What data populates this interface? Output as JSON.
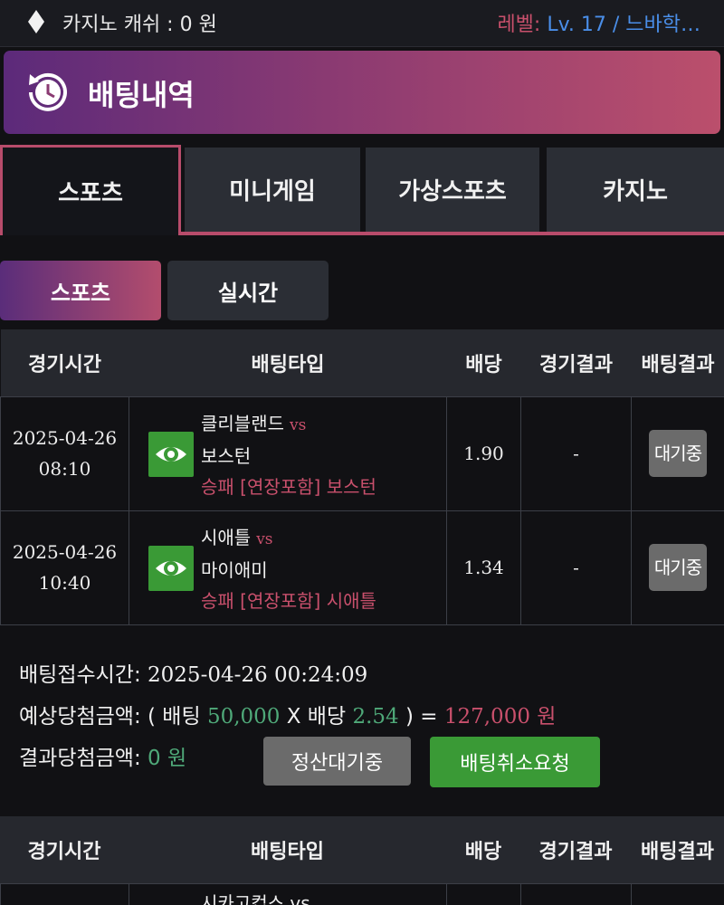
{
  "topbar": {
    "cash_label": "카지노 캐쉬 :  0 원",
    "level_prefix": "레벨: ",
    "level_value": "Lv. 17 / 느바학…"
  },
  "banner": {
    "title": "배팅내역",
    "icon": "history-clock-icon"
  },
  "tabs": [
    {
      "label": "스포츠",
      "active": true
    },
    {
      "label": "미니게임",
      "active": false
    },
    {
      "label": "가상스포츠",
      "active": false
    },
    {
      "label": "카지노",
      "active": false
    }
  ],
  "subtabs": [
    {
      "label": "스포츠",
      "active": true
    },
    {
      "label": "실시간",
      "active": false
    }
  ],
  "table_headers": [
    "경기시간",
    "배팅타입",
    "배당",
    "경기결과",
    "배팅결과"
  ],
  "bet_slip_1": {
    "rows": [
      {
        "date": "2025-04-26",
        "time": "08:10",
        "home": "클리블랜드",
        "vs": "vs",
        "away": "보스턴",
        "pick": "승패 [연장포함] 보스턴",
        "odds": "1.90",
        "result": "-",
        "status": "대기중"
      },
      {
        "date": "2025-04-26",
        "time": "10:40",
        "home": "시애틀",
        "vs": "vs",
        "away": "마이애미",
        "pick": "승패 [연장포함] 시애틀",
        "odds": "1.34",
        "result": "-",
        "status": "대기중"
      }
    ],
    "summary": {
      "time_label": "배팅접수시간: ",
      "time_value": "2025-04-26 00:24:09",
      "expected_label": "예상당첨금액: ( 배팅 ",
      "stake": "50,000",
      "x_odds": " X 배당 ",
      "total_odds": "2.54",
      "eq": " ) = ",
      "payout": "127,000 원",
      "result_label": "결과당첨금액: ",
      "result_value": "0 원",
      "settle_button": "정산대기중",
      "cancel_button": "배팅취소요청"
    }
  },
  "bet_slip_2": {
    "partial_text": "시카고컵스 vs"
  },
  "colors": {
    "accent": "#b84c6b",
    "green": "#3a9a36",
    "link_blue": "#4a8ee8"
  }
}
